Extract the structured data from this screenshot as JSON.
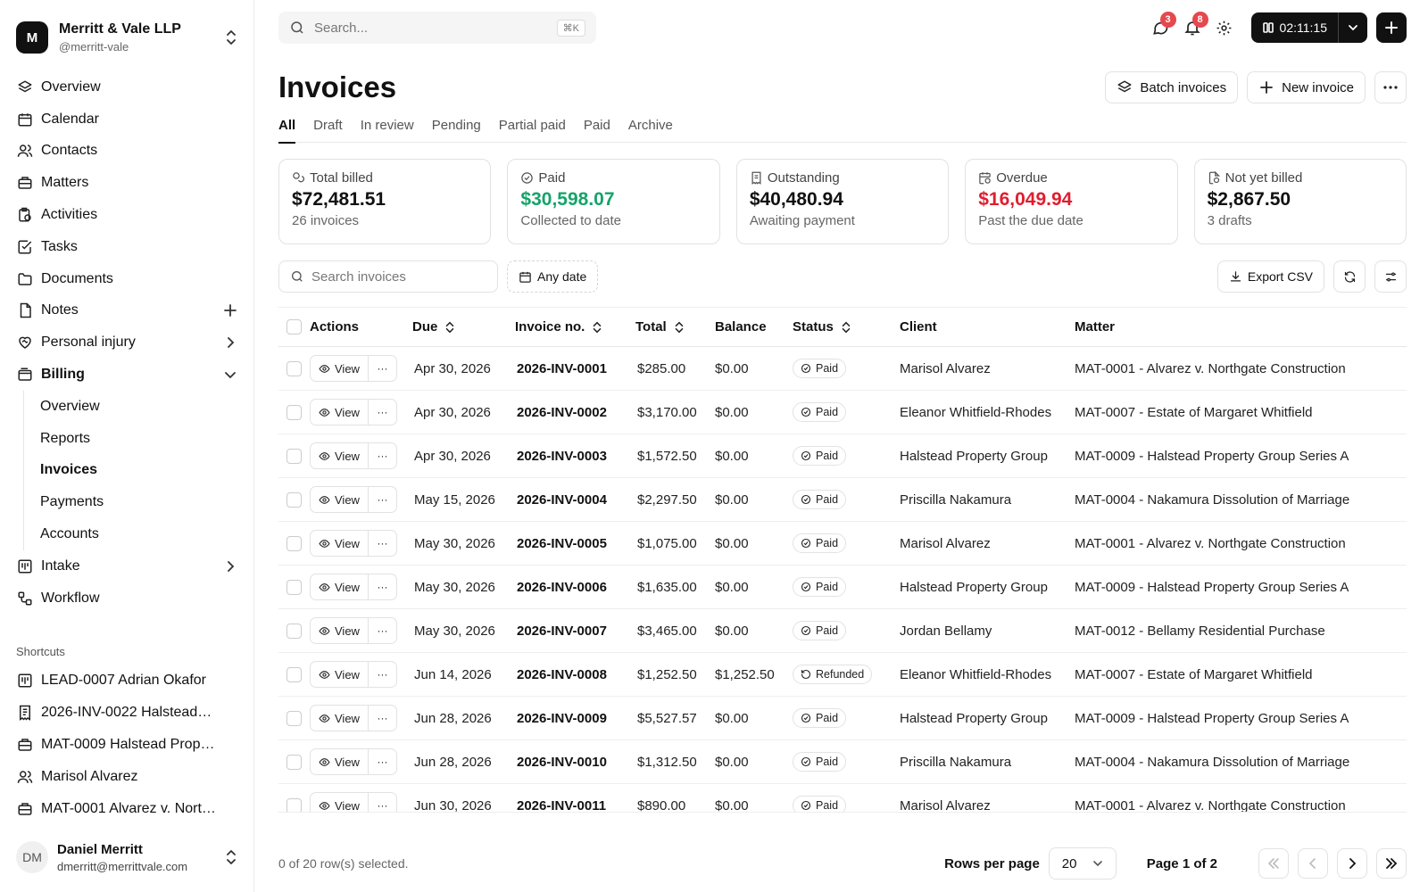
{
  "org": {
    "initial": "M",
    "name": "Merritt & Vale LLP",
    "handle": "@merritt-vale"
  },
  "nav": {
    "overview": "Overview",
    "calendar": "Calendar",
    "contacts": "Contacts",
    "matters": "Matters",
    "activities": "Activities",
    "tasks": "Tasks",
    "documents": "Documents",
    "notes": "Notes",
    "personal_injury": "Personal injury",
    "billing": "Billing",
    "billing_sub": [
      "Overview",
      "Reports",
      "Invoices",
      "Payments",
      "Accounts"
    ],
    "intake": "Intake",
    "workflow": "Workflow"
  },
  "shortcuts": {
    "title": "Shortcuts",
    "items": [
      "LEAD-0007 Adrian Okafor",
      "2026-INV-0022 Halstead…",
      "MAT-0009 Halstead Prop…",
      "Marisol Alvarez",
      "MAT-0001 Alvarez v. Nort…"
    ]
  },
  "user": {
    "initials": "DM",
    "name": "Daniel Merritt",
    "email": "dmerritt@merrittvale.com"
  },
  "topbar": {
    "search_placeholder": "Search...",
    "shortcut": "⌘K",
    "messages_count": "3",
    "notifications_count": "8",
    "timer": "02:11:15"
  },
  "page": {
    "title": "Invoices",
    "batch_label": "Batch invoices",
    "new_label": "New invoice",
    "tabs": [
      "All",
      "Draft",
      "In review",
      "Pending",
      "Partial paid",
      "Paid",
      "Archive"
    ]
  },
  "cards": [
    {
      "label": "Total billed",
      "value": "$72,481.51",
      "sub": "26 invoices",
      "color": "#111111"
    },
    {
      "label": "Paid",
      "value": "$30,598.07",
      "sub": "Collected to date",
      "color": "#16a36a"
    },
    {
      "label": "Outstanding",
      "value": "$40,480.94",
      "sub": "Awaiting payment",
      "color": "#111111"
    },
    {
      "label": "Overdue",
      "value": "$16,049.94",
      "sub": "Past the due date",
      "color": "#e11d2e"
    },
    {
      "label": "Not yet billed",
      "value": "$2,867.50",
      "sub": "3 drafts",
      "color": "#111111"
    }
  ],
  "filters": {
    "search_placeholder": "Search invoices",
    "date_label": "Any date",
    "export_label": "Export CSV"
  },
  "table": {
    "columns": [
      "Actions",
      "Due",
      "Invoice no.",
      "Total",
      "Balance",
      "Status",
      "Client",
      "Matter"
    ],
    "view_label": "View",
    "more_label": "···",
    "rows": [
      {
        "due": "Apr 30, 2026",
        "inv": "2026-INV-0001",
        "total": "$285.00",
        "balance": "$0.00",
        "status": "Paid",
        "client": "Marisol Alvarez",
        "matter": "MAT-0001 - Alvarez v. Northgate Construction"
      },
      {
        "due": "Apr 30, 2026",
        "inv": "2026-INV-0002",
        "total": "$3,170.00",
        "balance": "$0.00",
        "status": "Paid",
        "client": "Eleanor Whitfield-Rhodes",
        "matter": "MAT-0007 - Estate of Margaret Whitfield"
      },
      {
        "due": "Apr 30, 2026",
        "inv": "2026-INV-0003",
        "total": "$1,572.50",
        "balance": "$0.00",
        "status": "Paid",
        "client": "Halstead Property Group",
        "matter": "MAT-0009 - Halstead Property Group Series A"
      },
      {
        "due": "May 15, 2026",
        "inv": "2026-INV-0004",
        "total": "$2,297.50",
        "balance": "$0.00",
        "status": "Paid",
        "client": "Priscilla Nakamura",
        "matter": "MAT-0004 - Nakamura Dissolution of Marriage"
      },
      {
        "due": "May 30, 2026",
        "inv": "2026-INV-0005",
        "total": "$1,075.00",
        "balance": "$0.00",
        "status": "Paid",
        "client": "Marisol Alvarez",
        "matter": "MAT-0001 - Alvarez v. Northgate Construction"
      },
      {
        "due": "May 30, 2026",
        "inv": "2026-INV-0006",
        "total": "$1,635.00",
        "balance": "$0.00",
        "status": "Paid",
        "client": "Halstead Property Group",
        "matter": "MAT-0009 - Halstead Property Group Series A"
      },
      {
        "due": "May 30, 2026",
        "inv": "2026-INV-0007",
        "total": "$3,465.00",
        "balance": "$0.00",
        "status": "Paid",
        "client": "Jordan Bellamy",
        "matter": "MAT-0012 - Bellamy Residential Purchase"
      },
      {
        "due": "Jun 14, 2026",
        "inv": "2026-INV-0008",
        "total": "$1,252.50",
        "balance": "$1,252.50",
        "status": "Refunded",
        "client": "Eleanor Whitfield-Rhodes",
        "matter": "MAT-0007 - Estate of Margaret Whitfield"
      },
      {
        "due": "Jun 28, 2026",
        "inv": "2026-INV-0009",
        "total": "$5,527.57",
        "balance": "$0.00",
        "status": "Paid",
        "client": "Halstead Property Group",
        "matter": "MAT-0009 - Halstead Property Group Series A"
      },
      {
        "due": "Jun 28, 2026",
        "inv": "2026-INV-0010",
        "total": "$1,312.50",
        "balance": "$0.00",
        "status": "Paid",
        "client": "Priscilla Nakamura",
        "matter": "MAT-0004 - Nakamura Dissolution of Marriage"
      },
      {
        "due": "Jun 30, 2026",
        "inv": "2026-INV-0011",
        "total": "$890.00",
        "balance": "$0.00",
        "status": "Paid",
        "client": "Marisol Alvarez",
        "matter": "MAT-0001 - Alvarez v. Northgate Construction"
      }
    ]
  },
  "footer": {
    "selected": "0 of 20 row(s) selected.",
    "rows_per_page_label": "Rows per page",
    "rows_per_page": "20",
    "page_info": "Page 1 of 2"
  }
}
